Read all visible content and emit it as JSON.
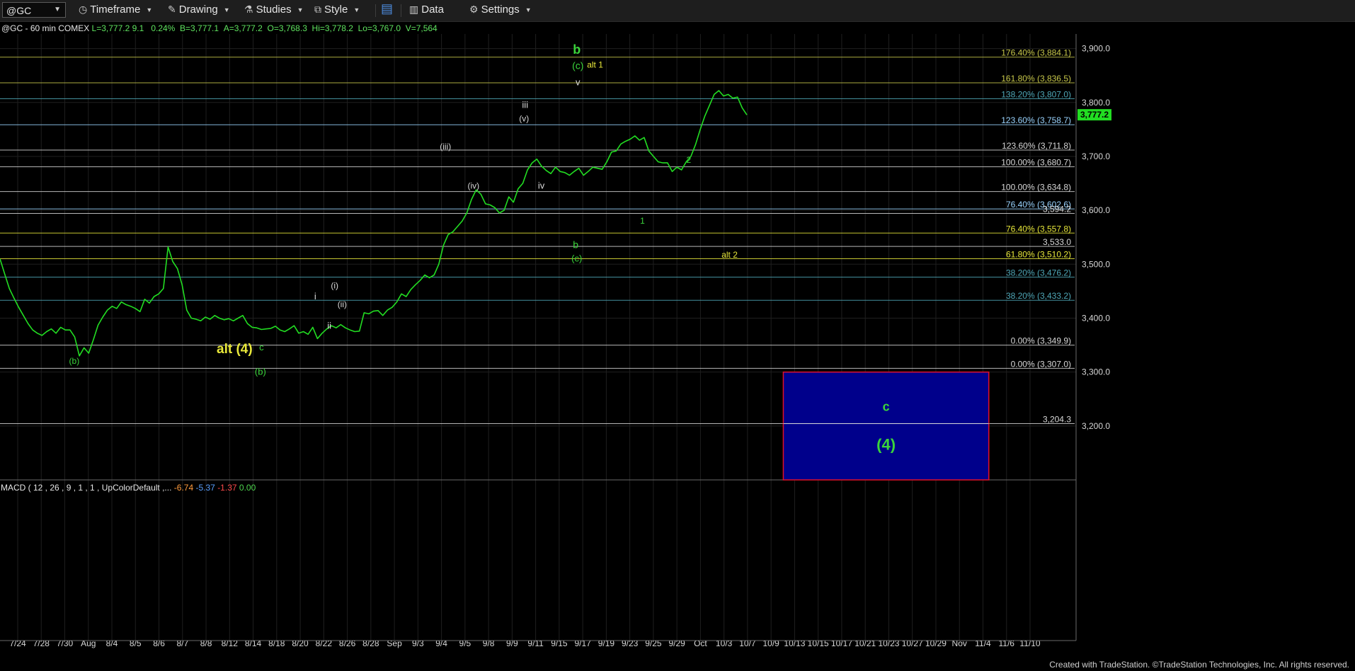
{
  "toolbar": {
    "symbol": "@GC",
    "timeframe_label": "Timeframe",
    "drawing_label": "Drawing",
    "studies_label": "Studies",
    "style_label": "Style",
    "data_label": "Data",
    "settings_label": "Settings"
  },
  "header": {
    "symbol_text": "@GC - 60 min  COMEX",
    "last": "L=3,777.2",
    "change": "9.1",
    "pct": "0.24%",
    "bid": "B=3,777.1",
    "ask": "A=3,777.2",
    "open": "O=3,768.3",
    "high": "Hi=3,778.2",
    "low": "Lo=3,767.0",
    "volume": "V=7,564"
  },
  "macd": {
    "label": "MACD ( 12 , 26 , 9 , 1 , 1 , UpColorDefault ,...",
    "v1": "-6.74",
    "v2": "-5.37",
    "v3": "-1.37",
    "v4": "0.00",
    "c1": "#ff9b3d",
    "c2": "#5aa0ff",
    "c3": "#ff4a4a",
    "c4": "#4fd64f"
  },
  "footer": "Created with TradeStation. ©TradeStation Technologies, Inc. All rights reserved.",
  "colors": {
    "price": "#22dd22",
    "green_label": "#3ad43a",
    "yellow_label": "#e8e83a",
    "white_label": "#d8d8d8",
    "box_fill": "#00008b",
    "box_border": "#e0102a"
  },
  "chart_data": {
    "type": "line",
    "title": "",
    "series": [
      {
        "values": [
          3510,
          3482,
          3455,
          3437,
          3420,
          3405,
          3390,
          3378,
          3372,
          3368,
          3375,
          3380,
          3372,
          3383,
          3378,
          3378,
          3365,
          3330,
          3345,
          3335,
          3360,
          3387,
          3402,
          3415,
          3422,
          3418,
          3430,
          3425,
          3422,
          3418,
          3412,
          3435,
          3428,
          3440,
          3445,
          3455,
          3532,
          3505,
          3492,
          3462,
          3415,
          3400,
          3398,
          3395,
          3402,
          3398,
          3405,
          3400,
          3397,
          3399,
          3395,
          3400,
          3405,
          3390,
          3383,
          3382,
          3379,
          3380,
          3381,
          3385,
          3378,
          3375,
          3380,
          3386,
          3372,
          3375,
          3370,
          3383,
          3362,
          3372,
          3380,
          3386,
          3382,
          3388,
          3382,
          3378,
          3375,
          3376,
          3410,
          3408,
          3413,
          3414,
          3405,
          3415,
          3420,
          3430,
          3445,
          3440,
          3453,
          3462,
          3470,
          3480,
          3475,
          3480,
          3500,
          3535,
          3555,
          3560,
          3570,
          3580,
          3595,
          3620,
          3638,
          3630,
          3612,
          3610,
          3605,
          3595,
          3600,
          3625,
          3615,
          3640,
          3650,
          3675,
          3688,
          3695,
          3682,
          3674,
          3668,
          3680,
          3672,
          3670,
          3665,
          3672,
          3678,
          3665,
          3672,
          3680,
          3678,
          3676,
          3690,
          3708,
          3710,
          3723,
          3728,
          3732,
          3738,
          3730,
          3735,
          3710,
          3700,
          3690,
          3688,
          3688,
          3672,
          3680,
          3675,
          3690,
          3700,
          3722,
          3750,
          3775,
          3795,
          3815,
          3822,
          3812,
          3815,
          3808,
          3810,
          3790,
          3777
        ]
      }
    ],
    "x_ticks": [
      "7/24",
      "7/28",
      "7/30",
      "Aug",
      "8/4",
      "8/5",
      "8/6",
      "8/7",
      "8/8",
      "8/12",
      "8/14",
      "8/18",
      "8/20",
      "8/22",
      "8/26",
      "8/28",
      "Sep",
      "9/3",
      "9/4",
      "9/5",
      "9/8",
      "9/9",
      "9/11",
      "9/15",
      "9/17",
      "9/19",
      "9/23",
      "9/25",
      "9/29",
      "Oct",
      "10/3",
      "10/7",
      "10/9",
      "10/13",
      "10/15",
      "10/17",
      "10/21",
      "10/23",
      "10/27",
      "10/29",
      "Nov",
      "11/4",
      "11/6",
      "11/10"
    ],
    "y_ticks": [
      "3,900.0",
      "3,800.0",
      "3,700.0",
      "3,600.0",
      "3,500.0",
      "3,400.0",
      "3,300.0",
      "3,200.0"
    ],
    "ylim": [
      3100,
      3910
    ],
    "y_tick_values": [
      3900,
      3800,
      3700,
      3600,
      3500,
      3400,
      3300,
      3200
    ],
    "last_price_label": "3,777.2",
    "fib_levels": [
      {
        "label": "176.40% (3,884.1)",
        "value": 3884.1,
        "color": "#c8c84a"
      },
      {
        "label": "161.80% (3,836.5)",
        "value": 3836.5,
        "color": "#c8c84a"
      },
      {
        "label": "138.20% (3,807.0)",
        "value": 3807.0,
        "color": "#4fa8b8"
      },
      {
        "label": "123.60% (3,758.7)",
        "value": 3758.7,
        "color": "#9ad4ff"
      },
      {
        "label": "123.60% (3,711.8)",
        "value": 3711.8,
        "color": "#d8d8d8"
      },
      {
        "label": "100.00% (3,680.7)",
        "value": 3680.7,
        "color": "#d8d8d8"
      },
      {
        "label": "100.00% (3,634.8)",
        "value": 3634.8,
        "color": "#d8d8d8"
      },
      {
        "label": "76.40% (3,602.6)",
        "value": 3602.6,
        "color": "#9ad4ff"
      },
      {
        "label": "3,594.2",
        "value": 3594.2,
        "color": "#d8d8d8"
      },
      {
        "label": "76.40% (3,557.8)",
        "value": 3557.8,
        "color": "#e8e83a"
      },
      {
        "label": "3,533.0",
        "value": 3533.0,
        "color": "#d8d8d8"
      },
      {
        "label": "61.80% (3,510.2)",
        "value": 3510.2,
        "color": "#e8e83a"
      },
      {
        "label": "38.20% (3,476.2)",
        "value": 3476.2,
        "color": "#4fa8b8"
      },
      {
        "label": "38.20% (3,433.2)",
        "value": 3433.2,
        "color": "#4fa8b8"
      },
      {
        "label": "0.00% (3,349.9)",
        "value": 3349.9,
        "color": "#d8d8d8"
      },
      {
        "label": "0.00% (3,307.0)",
        "value": 3307.0,
        "color": "#d8d8d8"
      },
      {
        "label": "3,204.3",
        "value": 3204.3,
        "color": "#d8d8d8"
      }
    ],
    "target_box": {
      "x_start_tick": "10/13",
      "x_end_tick": "11/6",
      "top": 3300,
      "bottom": 3100,
      "label_top": "c",
      "label_bottom": "(4)"
    },
    "annotations": [
      {
        "text": "b",
        "x": 0.535,
        "value": 3530,
        "color": "#3ad43a",
        "size": 14
      },
      {
        "text": "(c)",
        "x": 0.536,
        "value": 3505,
        "color": "#3ad43a",
        "size": 13
      },
      {
        "text": "(b)",
        "x": 0.069,
        "value": 3315,
        "color": "#3ad43a",
        "size": 12
      },
      {
        "text": "alt (4)",
        "x": 0.218,
        "value": 3335,
        "color": "#e8e83a",
        "size": 19,
        "bold": true
      },
      {
        "text": "c",
        "x": 0.243,
        "value": 3340,
        "color": "#3ad43a",
        "size": 13
      },
      {
        "text": "(b)",
        "x": 0.242,
        "value": 3295,
        "color": "#3ad43a",
        "size": 13
      },
      {
        "text": "i",
        "x": 0.293,
        "value": 3435,
        "color": "#d8d8d8",
        "size": 13
      },
      {
        "text": "ii",
        "x": 0.306,
        "value": 3380,
        "color": "#d8d8d8",
        "size": 13
      },
      {
        "text": "(i)",
        "x": 0.311,
        "value": 3455,
        "color": "#d8d8d8",
        "size": 12
      },
      {
        "text": "(ii)",
        "x": 0.318,
        "value": 3420,
        "color": "#d8d8d8",
        "size": 12
      },
      {
        "text": "(iii)",
        "x": 0.414,
        "value": 3713,
        "color": "#d8d8d8",
        "size": 12
      },
      {
        "text": "(iv)",
        "x": 0.44,
        "value": 3640,
        "color": "#d8d8d8",
        "size": 12
      },
      {
        "text": "iii",
        "x": 0.488,
        "value": 3790,
        "color": "#d8d8d8",
        "size": 13
      },
      {
        "text": "(v)",
        "x": 0.487,
        "value": 3765,
        "color": "#d8d8d8",
        "size": 12
      },
      {
        "text": "iv",
        "x": 0.503,
        "value": 3640,
        "color": "#d8d8d8",
        "size": 13
      },
      {
        "text": "v",
        "x": 0.537,
        "value": 3832,
        "color": "#d8d8d8",
        "size": 13
      },
      {
        "text": "b",
        "x": 0.536,
        "value": 3890,
        "color": "#3ad43a",
        "size": 18,
        "bold": true
      },
      {
        "text": "(c)",
        "x": 0.537,
        "value": 3862,
        "color": "#3ad43a",
        "size": 14
      },
      {
        "text": "alt 1",
        "x": 0.553,
        "value": 3865,
        "color": "#e8e83a",
        "size": 12
      },
      {
        "text": "2",
        "x": 0.64,
        "value": 3688,
        "color": "#3ad43a",
        "size": 12
      },
      {
        "text": "1",
        "x": 0.597,
        "value": 3575,
        "color": "#3ad43a",
        "size": 12
      },
      {
        "text": "alt 2",
        "x": 0.678,
        "value": 3512,
        "color": "#e8e83a",
        "size": 12
      }
    ],
    "grid": true,
    "legend": "none"
  }
}
